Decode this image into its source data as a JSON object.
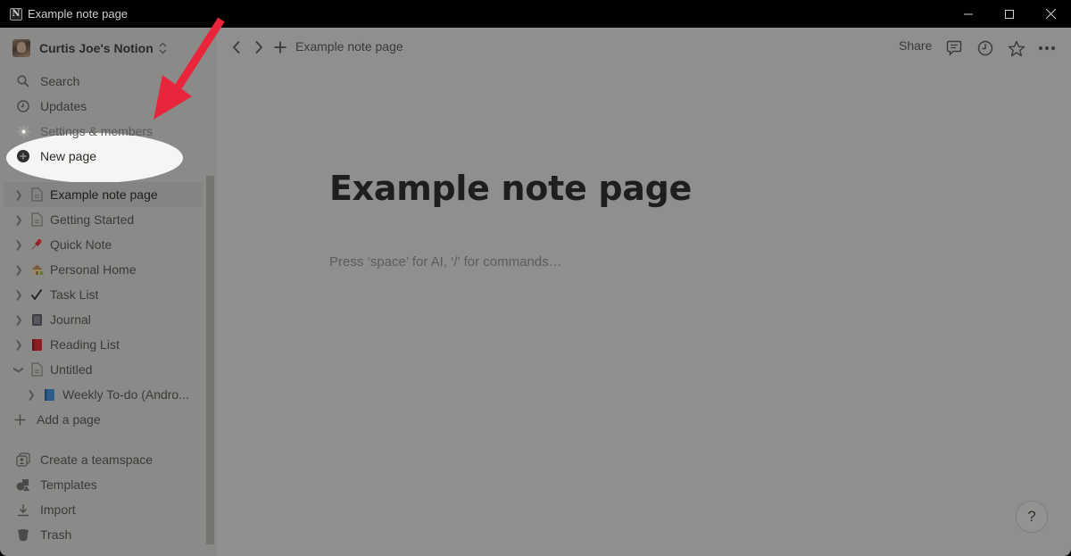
{
  "window": {
    "title": "Example note page",
    "controls": [
      "minimize",
      "maximize",
      "close"
    ]
  },
  "sidebar": {
    "workspace_name": "Curtis Joe's Notion",
    "nav_items": [
      {
        "label": "Search",
        "icon": "search-icon"
      },
      {
        "label": "Updates",
        "icon": "clock-icon"
      },
      {
        "label": "Settings & members",
        "icon": "gear-icon"
      },
      {
        "label": "New page",
        "icon": "plus-circle-icon"
      }
    ],
    "pages": [
      {
        "label": "Example note page",
        "icon": "document-icon",
        "expanded": false,
        "active": true
      },
      {
        "label": "Getting Started",
        "icon": "document-icon",
        "expanded": false
      },
      {
        "label": "Quick Note",
        "icon": "pushpin-icon",
        "expanded": false
      },
      {
        "label": "Personal Home",
        "icon": "house-icon",
        "expanded": false
      },
      {
        "label": "Task List",
        "icon": "checkmark-icon",
        "expanded": false
      },
      {
        "label": "Journal",
        "icon": "notebook-icon",
        "expanded": false
      },
      {
        "label": "Reading List",
        "icon": "red-book-icon",
        "expanded": false
      },
      {
        "label": "Untitled",
        "icon": "document-icon",
        "expanded": true
      },
      {
        "label": "Weekly To-do (Andro...",
        "icon": "blue-book-icon",
        "expanded": false,
        "child": true
      }
    ],
    "add_page": "Add a page",
    "footer_items": [
      {
        "label": "Create a teamspace",
        "icon": "teamspace-icon"
      },
      {
        "label": "Templates",
        "icon": "templates-icon"
      },
      {
        "label": "Import",
        "icon": "import-icon"
      },
      {
        "label": "Trash",
        "icon": "trash-icon"
      }
    ]
  },
  "topbar": {
    "breadcrumb": "Example note page",
    "share_label": "Share"
  },
  "page": {
    "title": "Example note page",
    "placeholder": "Press ‘space’ for AI, ‘/’ for commands…"
  },
  "help_label": "?",
  "annotation": {
    "highlight_target": "Settings & members",
    "arrow_color": "#e8253a",
    "highlight_color": "#f5f5f3"
  }
}
